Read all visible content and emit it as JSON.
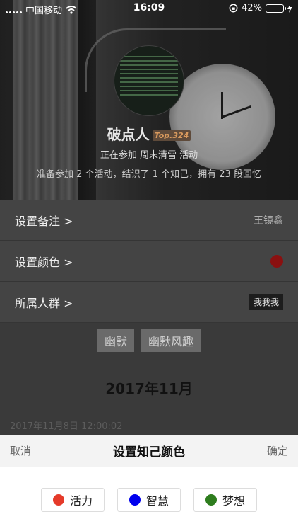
{
  "status_bar": {
    "carrier": "中国移动",
    "time": "16:09",
    "battery_percent": "42%",
    "battery_level": 0.42
  },
  "hero": {
    "name": "破点人",
    "rank_tag": "Top.324",
    "line1": "正在参加 周末清雷 活动",
    "line2": "准备参加 2 个活动，结识了 1 个知己，拥有 23 段回忆"
  },
  "settings": {
    "remark": {
      "label": "设置备注 >",
      "value": "王镜鑫"
    },
    "color": {
      "label": "设置颜色 >",
      "dot_color": "#8a1010"
    },
    "group": {
      "label": "所属人群 >",
      "value": "我我我"
    }
  },
  "tags": [
    "幽默",
    "幽默风趣"
  ],
  "month_header": "2017年11月",
  "timestamp": "2017年11月8日 12:00:02",
  "sheet": {
    "cancel": "取消",
    "title": "设置知己颜色",
    "confirm": "确定",
    "options": [
      {
        "label": "活力",
        "color": "#e53a2a"
      },
      {
        "label": "智慧",
        "color": "#0000ee"
      },
      {
        "label": "梦想",
        "color": "#2e7d1e"
      }
    ]
  }
}
